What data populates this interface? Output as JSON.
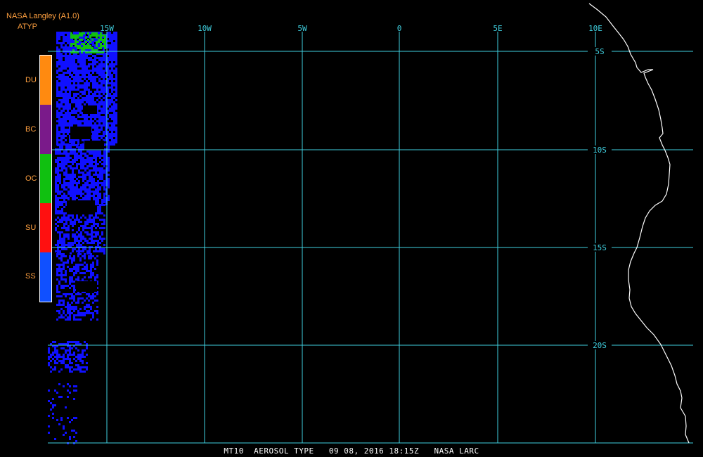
{
  "header": {
    "source": "NASA Langley (A1.0)",
    "product": "ATYP"
  },
  "legend": {
    "items": [
      {
        "label": "DU",
        "color": "#ff8a10"
      },
      {
        "label": "BC",
        "color": "#7a1a8a"
      },
      {
        "label": "OC",
        "color": "#10c010"
      },
      {
        "label": "SU",
        "color": "#ff1010"
      },
      {
        "label": "SS",
        "color": "#1050ff"
      }
    ]
  },
  "grid": {
    "color": "#40d0e0",
    "longitudes": [
      "15W",
      "10W",
      "5W",
      "0",
      "5E",
      "10E"
    ],
    "latitudes": [
      "5S",
      "10S",
      "15S",
      "20S"
    ]
  },
  "coastline_color": "#ffffff",
  "aerosol_colors": {
    "sea_salt": "#1010ff",
    "organic_carbon": "#10c010"
  },
  "footer": {
    "text": "MT10  AEROSOL TYPE   09 08, 2016 18:15Z   NASA LARC"
  }
}
